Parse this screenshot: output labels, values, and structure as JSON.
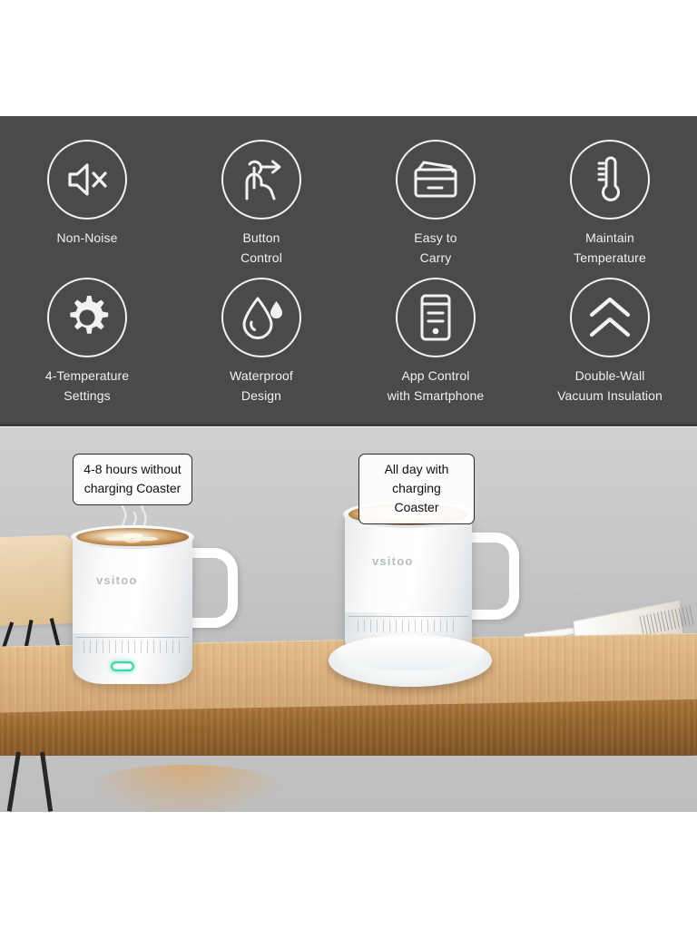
{
  "image": {
    "kind": "product-feature-graphic",
    "brand": "vsitoo",
    "colors": {
      "panel_background": "#4a4a4a",
      "panel_text": "#f0f0f0",
      "icon_stroke": "#f2f2f2",
      "wall": "#c6c7c8",
      "table_top": "#ddb482",
      "table_edge": "#9a682f",
      "led_indicator": "#3fd6b0",
      "callout_border": "#2b2b2b",
      "callout_background": "#ffffff",
      "page_background": "#ffffff"
    }
  },
  "features": {
    "rows": [
      [
        {
          "icon": "mute-speaker-icon",
          "label": "Non-Noise"
        },
        {
          "icon": "hand-tap-arrow-icon",
          "label": "Button\nControl"
        },
        {
          "icon": "briefcase-icon",
          "label": "Easy to\nCarry"
        },
        {
          "icon": "thermometer-icon",
          "label": "Maintain\nTemperature"
        }
      ],
      [
        {
          "icon": "gear-icon",
          "label": "4-Temperature\nSettings"
        },
        {
          "icon": "water-drop-icon",
          "label": "Waterproof\nDesign"
        },
        {
          "icon": "smartphone-icon",
          "label": "App Control\nwith Smartphone"
        },
        {
          "icon": "double-chevron-up-icon",
          "label": "Double-Wall\nVacuum Insulation"
        }
      ]
    ]
  },
  "scene": {
    "callouts": [
      {
        "name": "left-callout",
        "text": "4-8 hours without\ncharging Coaster"
      },
      {
        "name": "right-callout",
        "text": "All day with\ncharging Coaster"
      }
    ],
    "mugs": [
      {
        "name": "mug-without-coaster",
        "brand": "vsitoo",
        "has_coaster": false,
        "indicator": "on"
      },
      {
        "name": "mug-with-coaster",
        "brand": "vsitoo",
        "has_coaster": true,
        "indicator": "on"
      }
    ],
    "props": [
      {
        "name": "wooden-chair"
      },
      {
        "name": "wooden-table"
      },
      {
        "name": "magazine"
      }
    ]
  }
}
